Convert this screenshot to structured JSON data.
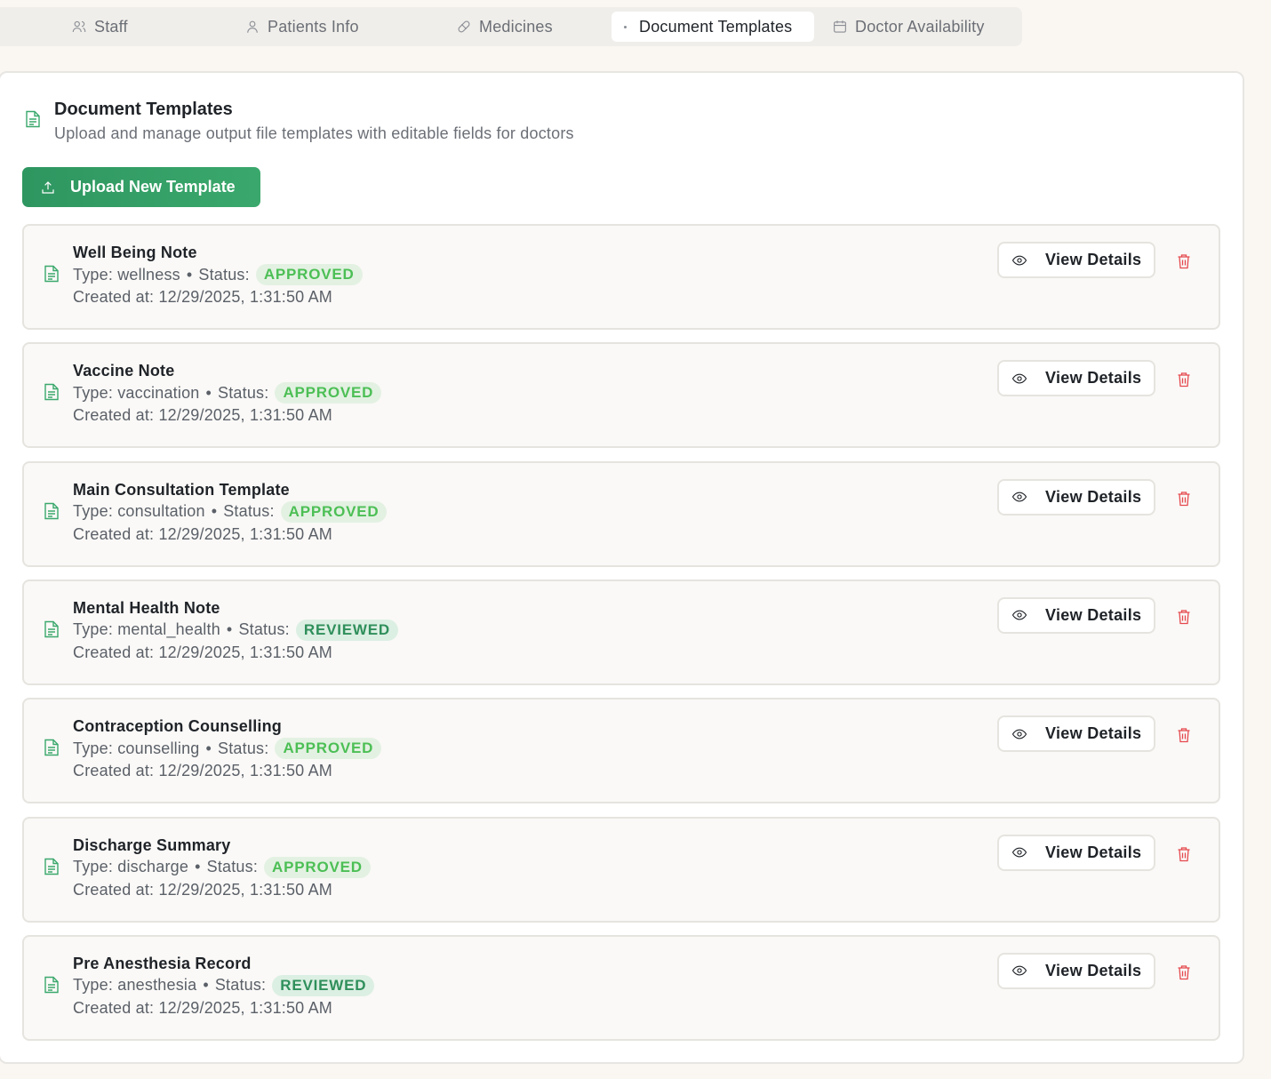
{
  "tabs": [
    {
      "label": "Staff",
      "icon": "users-icon"
    },
    {
      "label": "Patients Info",
      "icon": "user-icon"
    },
    {
      "label": "Medicines",
      "icon": "pill-icon"
    },
    {
      "label": "Document Templates",
      "icon": "file-icon",
      "active": true
    },
    {
      "label": "Doctor Availability",
      "icon": "calendar-icon"
    }
  ],
  "section": {
    "title": "Document Templates",
    "subtitle": "Upload and manage output file templates with editable fields for doctors",
    "upload_label": "Upload New Template"
  },
  "labels": {
    "type_prefix": "Type:",
    "status_prefix": "Status:",
    "separator": "•",
    "view_details": "View Details"
  },
  "templates": [
    {
      "name": "Well Being Note",
      "type": "wellness",
      "status": "APPROVED",
      "created": "Created at: 12/29/2025, 1:31:50 AM"
    },
    {
      "name": "Vaccine Note",
      "type": "vaccination",
      "status": "APPROVED",
      "created": "Created at: 12/29/2025, 1:31:50 AM"
    },
    {
      "name": "Main Consultation Template",
      "type": "consultation",
      "status": "APPROVED",
      "created": "Created at: 12/29/2025, 1:31:50 AM"
    },
    {
      "name": "Mental Health Note",
      "type": "mental_health",
      "status": "REVIEWED",
      "created": "Created at: 12/29/2025, 1:31:50 AM"
    },
    {
      "name": "Contraception Counselling",
      "type": "counselling",
      "status": "APPROVED",
      "created": "Created at: 12/29/2025, 1:31:50 AM"
    },
    {
      "name": "Discharge Summary",
      "type": "discharge",
      "status": "APPROVED",
      "created": "Created at: 12/29/2025, 1:31:50 AM"
    },
    {
      "name": "Pre Anesthesia Record",
      "type": "anesthesia",
      "status": "REVIEWED",
      "created": "Created at: 12/29/2025, 1:31:50 AM"
    }
  ],
  "colors": {
    "accent_green": "#2e9e62",
    "approved_text": "#4cbf55",
    "reviewed_text": "#2f8f5b",
    "delete_red": "#e5484d"
  }
}
